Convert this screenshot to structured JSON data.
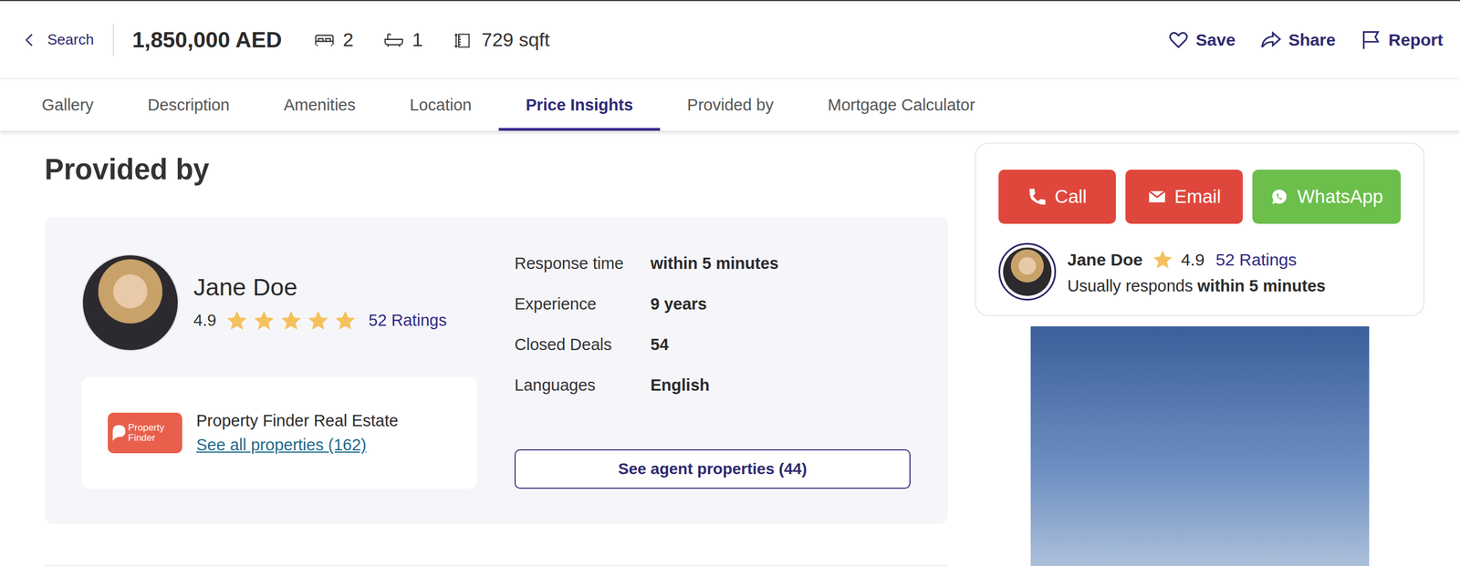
{
  "header": {
    "back": "Search",
    "price": "1,850,000 AED",
    "beds": "2",
    "baths": "1",
    "area": "729 sqft",
    "actions": [
      {
        "label": "Save",
        "kind": "save"
      },
      {
        "label": "Share",
        "kind": "share"
      },
      {
        "label": "Report",
        "kind": "report"
      }
    ]
  },
  "tabs": [
    {
      "label": "Gallery",
      "selected": false
    },
    {
      "label": "Description",
      "selected": false
    },
    {
      "label": "Amenities",
      "selected": false
    },
    {
      "label": "Location",
      "selected": false
    },
    {
      "label": "Price Insights",
      "selected": true
    },
    {
      "label": "Provided by",
      "selected": false
    },
    {
      "label": "Mortgage Calculator",
      "selected": false
    }
  ],
  "section": {
    "title": "Provided by"
  },
  "agent": {
    "name": "Jane Doe",
    "rating": "4.9",
    "stars": 5,
    "ratings": "52 Ratings"
  },
  "agency": {
    "logo": [
      "Property",
      "Finder"
    ],
    "name": "Property Finder Real Estate",
    "link": "See all properties (162)"
  },
  "stats": [
    {
      "label": "Response time",
      "value": "within 5 minutes"
    },
    {
      "label": "Experience",
      "value": "9 years"
    },
    {
      "label": "Closed Deals",
      "value": "54"
    },
    {
      "label": "Languages",
      "value": "English"
    }
  ],
  "agent_properties_button": "See agent properties (44)",
  "contact": {
    "buttons": [
      {
        "label": "Call",
        "kind": "call",
        "color": "#e0473c"
      },
      {
        "label": "Email",
        "kind": "email",
        "color": "#e0473c"
      },
      {
        "label": "WhatsApp",
        "kind": "whatsapp",
        "color": "#6cbf4b"
      }
    ],
    "agent_name": "Jane Doe",
    "rating": "4.9",
    "ratings": "52 Ratings",
    "response_prefix": "Usually responds",
    "response_time": "within 5 minutes"
  }
}
